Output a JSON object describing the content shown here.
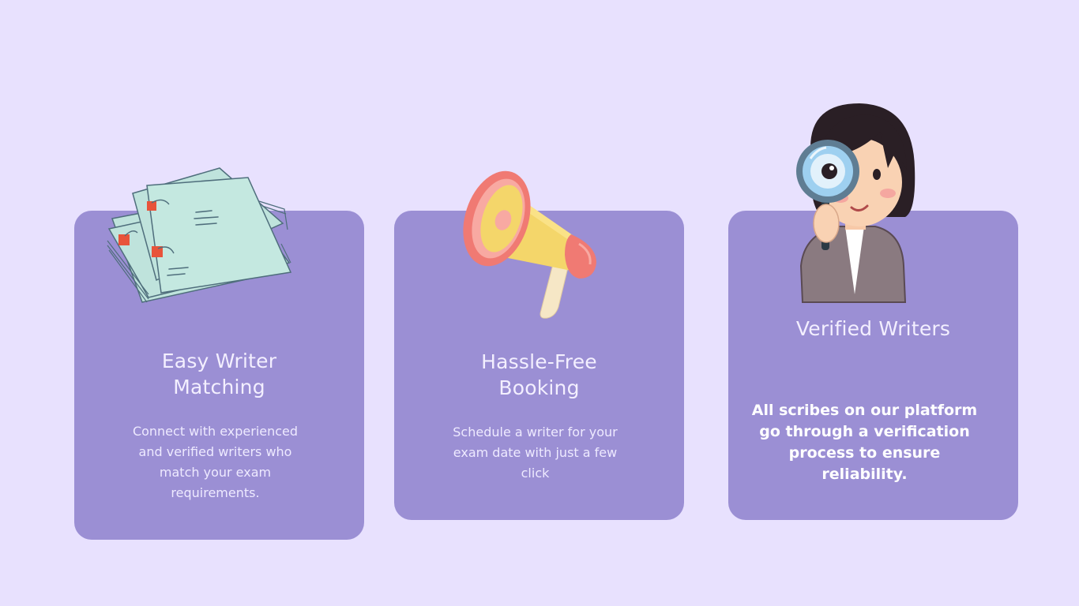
{
  "features": [
    {
      "icon": "papers-icon",
      "title_line1": "Easy Writer",
      "title_line2": "Matching",
      "desc_lines": [
        "Connect with experienced",
        "and verified writers who",
        "match your exam",
        "requirements."
      ]
    },
    {
      "icon": "megaphone-icon",
      "title_line1": "Hassle-Free",
      "title_line2": "Booking",
      "desc_lines": [
        "Schedule a writer for your",
        "exam date with just a few",
        "click"
      ]
    },
    {
      "icon": "magnifier-girl-icon",
      "title_line1": "Verified Writers",
      "desc_lines": [
        "All scribes on our platform",
        "go through a verification",
        "process to ensure",
        "reliability."
      ]
    }
  ],
  "colors": {
    "background": "#e8e1fe",
    "card": "#9b8fd4",
    "text": "#f3efff"
  }
}
